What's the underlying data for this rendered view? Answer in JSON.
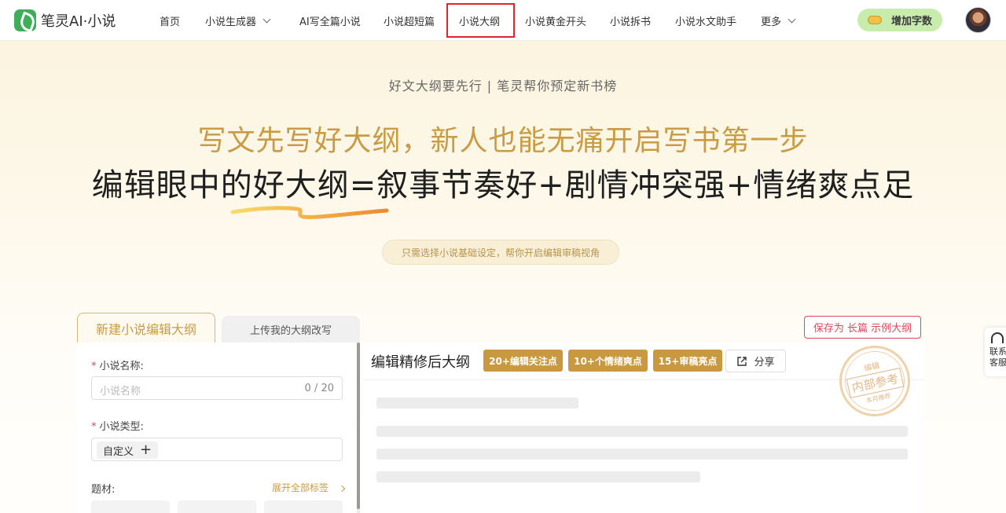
{
  "brand": {
    "name": "笔灵AI·小说"
  },
  "nav": {
    "items": [
      {
        "label": "首页"
      },
      {
        "label": "小说生成器"
      },
      {
        "label": "AI写全篇小说"
      },
      {
        "label": "小说超短篇"
      },
      {
        "label": "小说大纲"
      },
      {
        "label": "小说黄金开头"
      },
      {
        "label": "小说拆书"
      },
      {
        "label": "小说水文助手"
      },
      {
        "label": "更多"
      }
    ],
    "add_words": "增加字数"
  },
  "hero": {
    "subline": "好文大纲要先行 | 笔灵帮你预定新书榜",
    "headline": "写文先写好大纲，新人也能无痛开启写书第一步",
    "formula": "编辑眼中的好大纲=叙事节奏好+剧情冲突强+情绪爽点足",
    "pill": "只需选择小说基础设定，帮你开启编辑审稿视角"
  },
  "tabs": {
    "new": "新建小说编辑大纲",
    "upload": "上传我的大纲改写"
  },
  "save_button": "保存为 长篇 示例大纲",
  "form": {
    "required_mark": "*",
    "name_label": "小说名称:",
    "name_placeholder": "小说名称",
    "name_count": "0 / 20",
    "type_label": "小说类型:",
    "type_tag": "自定义",
    "type_add": "+",
    "theme_label": "题材:",
    "expand_all": "展开全部标签"
  },
  "panel": {
    "title": "编辑精修后大纲",
    "badges": [
      "20+编辑关注点",
      "10+个情绪爽点",
      "15+审稿亮点"
    ],
    "share": "分享",
    "stamp": {
      "top": "编辑",
      "main": "内部参考",
      "bottom": "本月推荐"
    }
  },
  "contact": {
    "line1": "联系",
    "line2": "客服"
  },
  "colors": {
    "gold": "#c89b44",
    "accent_red": "#e0252b",
    "green": "#c7ecac"
  }
}
